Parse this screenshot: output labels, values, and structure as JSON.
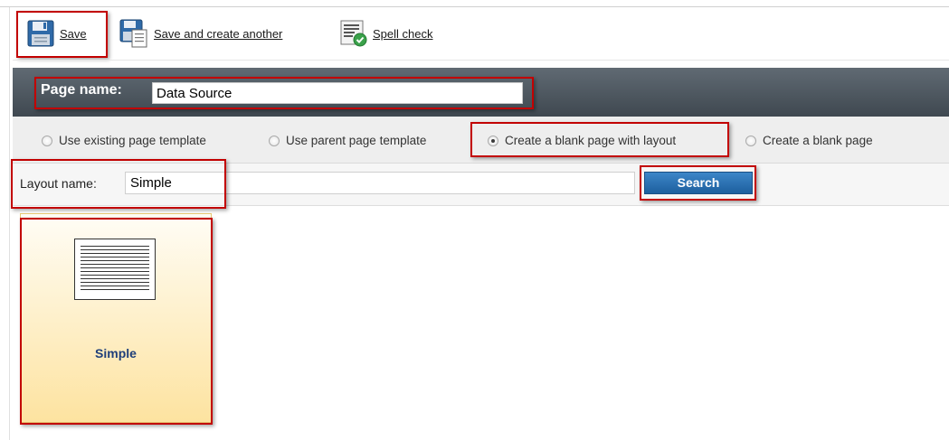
{
  "toolbar": {
    "save_label": "Save",
    "save_create_label": "Save and create another",
    "spell_check_label": "Spell check"
  },
  "page_name": {
    "label": "Page name:",
    "value": "Data Source"
  },
  "template_options": [
    {
      "label": "Use existing page template",
      "checked": false
    },
    {
      "label": "Use parent page template",
      "checked": false
    },
    {
      "label": "Create a blank page with layout",
      "checked": true
    },
    {
      "label": "Create a blank page",
      "checked": false
    }
  ],
  "layout_search": {
    "label": "Layout name:",
    "value": "Simple",
    "button_label": "Search"
  },
  "layouts": [
    {
      "name": "Simple",
      "selected": true
    }
  ],
  "colors": {
    "header": "#4a545c",
    "accent_button": "#2a6fb0",
    "annotation": "#c20000",
    "tile_selected": "#fde3a0"
  },
  "icons": {
    "save": "floppy-disk-icon",
    "save_create": "floppy-new-document-icon",
    "spell_check": "spell-check-icon"
  }
}
